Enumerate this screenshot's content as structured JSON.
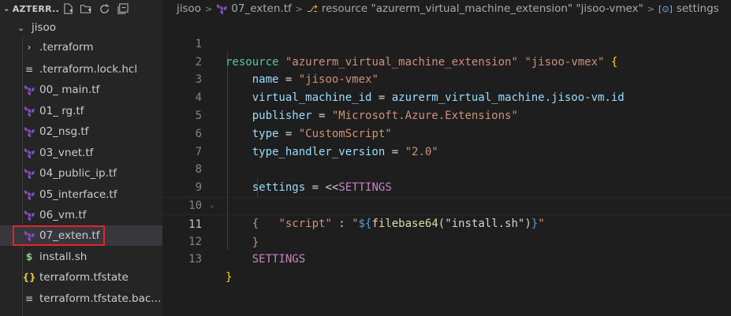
{
  "explorer": {
    "title": "AZTERR...",
    "folder": "jisoo",
    "items": [
      {
        "label": ".terraform",
        "icon": "chevron-right-icon"
      },
      {
        "label": ".terraform.lock.hcl",
        "icon": "lines-icon"
      },
      {
        "label": "00_ main.tf",
        "icon": "terraform-icon"
      },
      {
        "label": "01_ rg.tf",
        "icon": "terraform-icon"
      },
      {
        "label": "02_nsg.tf",
        "icon": "terraform-icon"
      },
      {
        "label": "03_vnet.tf",
        "icon": "terraform-icon"
      },
      {
        "label": "04_public_ip.tf",
        "icon": "terraform-icon"
      },
      {
        "label": "05_interface.tf",
        "icon": "terraform-icon"
      },
      {
        "label": "06_vm.tf",
        "icon": "terraform-icon"
      },
      {
        "label": "07_exten.tf",
        "icon": "terraform-icon"
      },
      {
        "label": "install.sh",
        "icon": "dollar-icon"
      },
      {
        "label": "terraform.tfstate",
        "icon": "braces-icon"
      },
      {
        "label": "terraform.tfstate.bac...",
        "icon": "lines-icon"
      }
    ],
    "selected_index": 9
  },
  "breadcrumb": {
    "folder": "jisoo",
    "file": "07_exten.tf",
    "resource": "resource \"azurerm_virtual_machine_extension\" \"jisoo-vmex\"",
    "symbol": "settings"
  },
  "editor": {
    "current_line": 11,
    "line_numbers": [
      "1",
      "2",
      "3",
      "4",
      "5",
      "6",
      "7",
      "8",
      "9",
      "10",
      "11",
      "12",
      "13"
    ],
    "code": {
      "l1_kw": "resource",
      "l1_s1": "\"azurerm_virtual_machine_extension\"",
      "l1_s2": "\"jisoo-vmex\"",
      "l1_brace": "{",
      "l2_prop": "name",
      "l2_val": "\"jisoo-vmex\"",
      "l3_prop": "virtual_machine_id",
      "l3_val": "azurerm_virtual_machine.jisoo-vm.id",
      "l4_prop": "publisher",
      "l4_val": "\"Microsoft.Azure.Extensions\"",
      "l5_prop": "type",
      "l5_val": "\"CustomScript\"",
      "l6_prop": "type_handler_version",
      "l6_val": "\"2.0\"",
      "l8_prop": "settings",
      "l8_heredoc": "<<",
      "l8_marker": "SETTINGS",
      "l9_brace": "{",
      "l10_key": "\"script\"",
      "l10_colon": " : ",
      "l10_q1": "\"",
      "l10_interp_open": "${",
      "l10_fn": "filebase64",
      "l10_arg": "(\"install.sh\")",
      "l10_interp_close": "}",
      "l10_q2": "\"",
      "l11_brace": "}",
      "l12_marker": "SETTINGS",
      "l13_brace": "}",
      "eq": " = "
    }
  }
}
